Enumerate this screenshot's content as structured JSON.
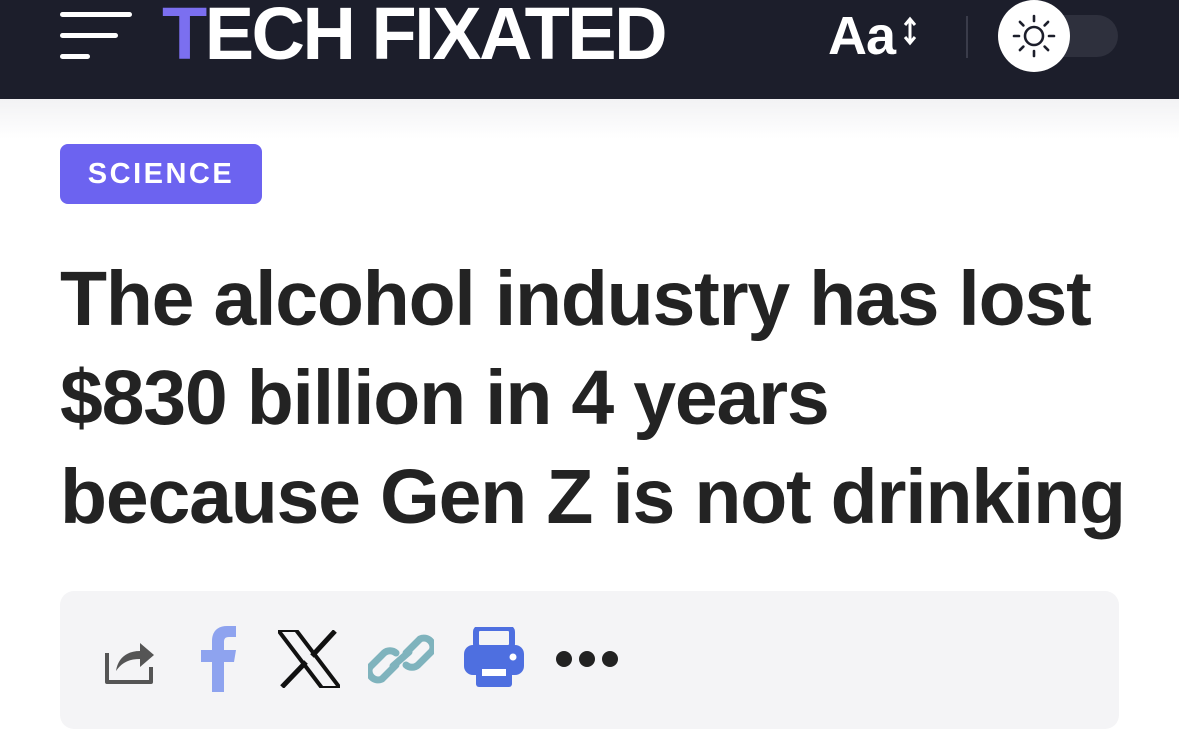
{
  "header": {
    "logo_first_letter": "T",
    "logo_rest": "ECH FIXATED",
    "font_size_label": "Aa",
    "theme": "light"
  },
  "article": {
    "category": "SCIENCE",
    "headline": "The alcohol industry has lost $830 billion in 4 years because Gen Z is not drinking"
  },
  "share_bar": {
    "items": [
      "share-icon",
      "facebook-icon",
      "x-icon",
      "link-icon",
      "print-icon",
      "more-icon"
    ]
  },
  "colors": {
    "header_bg": "#1c1e2b",
    "accent": "#6c63f0",
    "logo_accent": "#7b6ff0",
    "headline": "#232323",
    "share_bar_bg": "#f4f4f6",
    "facebook": "#8ea3ef",
    "link": "#7fb3bd",
    "print": "#4e6fe0"
  }
}
